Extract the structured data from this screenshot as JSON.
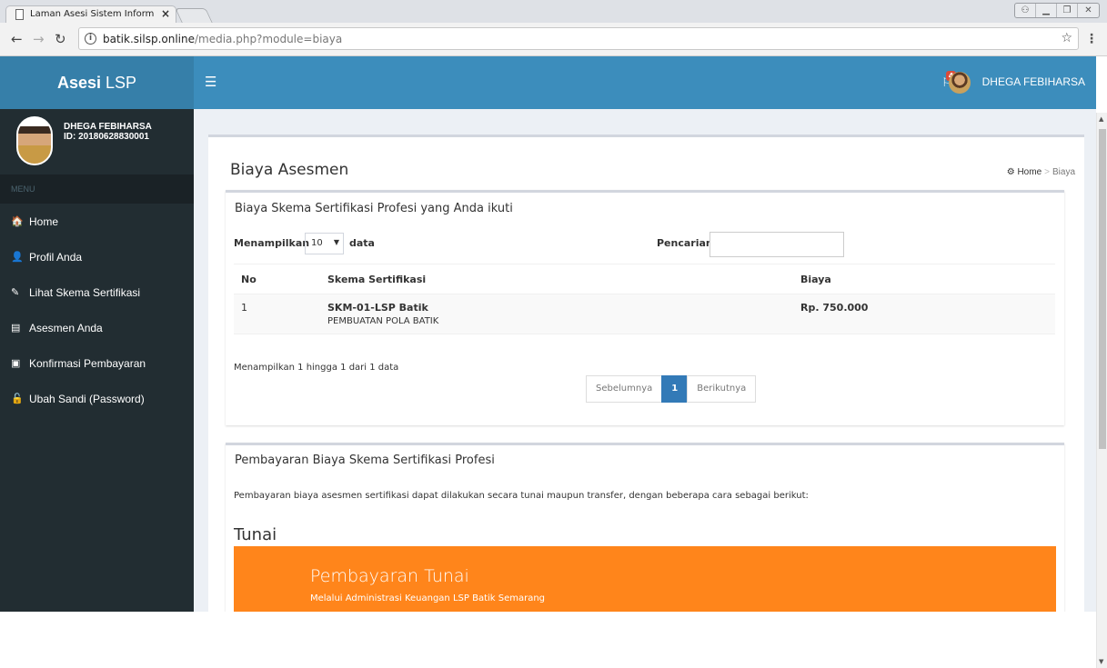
{
  "browser": {
    "tab_title": "Laman Asesi Sistem Inform",
    "url_host": "batik.silsp.online",
    "url_path": "/media.php?module=biaya",
    "info_glyph": "i"
  },
  "header": {
    "logo_bold": "Asesi",
    "logo_rest": " LSP",
    "notification_count": "4",
    "user_name": "DHEGA FEBIHARSA"
  },
  "sidebar": {
    "user_name": "DHEGA FEBIHARSA",
    "user_id": "ID: 20180628830001",
    "menu_header": "MENU",
    "items": [
      {
        "label": "Home",
        "icon": "home-icon",
        "glyph": "🏠"
      },
      {
        "label": "Profil Anda",
        "icon": "user-icon",
        "glyph": "👤"
      },
      {
        "label": "Lihat Skema Sertifikasi",
        "icon": "edit-icon",
        "glyph": "✎"
      },
      {
        "label": "Asesmen Anda",
        "icon": "document-icon",
        "glyph": "▤"
      },
      {
        "label": "Konfirmasi Pembayaran",
        "icon": "money-icon",
        "glyph": "▣"
      },
      {
        "label": "Ubah Sandi (Password)",
        "icon": "unlock-icon",
        "glyph": "🔓"
      }
    ]
  },
  "page": {
    "title": "Biaya Asesmen",
    "breadcrumb_home": "Home",
    "breadcrumb_sep": ">",
    "breadcrumb_current": "Biaya"
  },
  "table_box": {
    "title": "Biaya Skema Sertifikasi Profesi yang Anda ikuti",
    "show_label": "Menampilkan",
    "page_size": "10",
    "data_label": "data",
    "search_label": "Pencarian:",
    "columns": [
      "No",
      "Skema Sertifikasi",
      "Biaya"
    ],
    "rows": [
      {
        "no": "1",
        "code": "SKM-01-LSP Batik",
        "name": "PEMBUATAN POLA BATIK",
        "price": "Rp. 750.000"
      }
    ],
    "info": "Menampilkan 1 hingga 1 dari 1 data",
    "prev": "Sebelumnya",
    "page": "1",
    "next": "Berikutnya"
  },
  "payment_box": {
    "title": "Pembayaran Biaya Skema Sertifikasi Profesi",
    "description": "Pembayaran biaya asesmen sertifikasi dapat dilakukan secara tunai maupun transfer, dengan beberapa cara sebagai berikut:",
    "section": "Tunai",
    "card_title": "Pembayaran Tunai",
    "card_subtitle": "Melalui Administrasi Keuangan LSP Batik Semarang"
  },
  "colors": {
    "header_blue": "#3c8dbc",
    "logo_blue": "#367fa9",
    "sidebar_dark": "#222d32",
    "orange": "#ff851b"
  }
}
